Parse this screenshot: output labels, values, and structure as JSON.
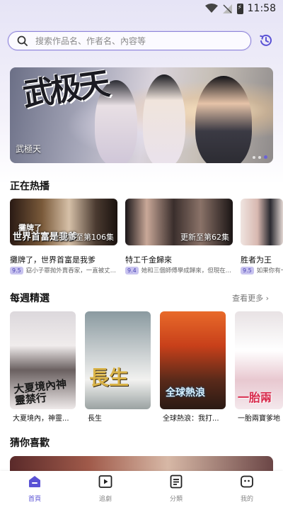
{
  "status_bar": {
    "time": "11:58"
  },
  "search": {
    "placeholder": "搜索作品名、作者名、內容等"
  },
  "banner": {
    "calligraphy": "武极天",
    "title": "武極天"
  },
  "sections": {
    "hot": {
      "title": "正在热播"
    },
    "weekly": {
      "title": "每週精選",
      "more": "查看更多 ›"
    },
    "guess": {
      "title": "猜你喜歡"
    }
  },
  "hot_items": [
    {
      "name": "攤牌了，世界首富是我爹",
      "score": "9.5",
      "desc": "窈小子罪抛外賣吞家，一直被丈...",
      "episodes": "更新至第106集",
      "overlay_top": "攤牌了",
      "overlay": "世界首富是我爹"
    },
    {
      "name": "特工千金歸來",
      "score": "9.4",
      "desc": "她和三個師傅學成歸來，但現在...",
      "episodes": "更新至第62集"
    },
    {
      "name": "胜者为王",
      "score": "9.5",
      "desc": "如果你有一"
    }
  ],
  "weekly_items": [
    {
      "name": "大夏境內，神靈...",
      "poster_text": "大夏境內神靈禁行"
    },
    {
      "name": "長生",
      "poster_text": "長生"
    },
    {
      "name": "全球熱浪：我打...",
      "poster_text": "全球熱浪"
    },
    {
      "name": "一胎兩寶爹地",
      "poster_text": "一胎兩"
    }
  ],
  "tabs": [
    {
      "label": "首頁",
      "icon": "home-icon",
      "active": true
    },
    {
      "label": "追劇",
      "icon": "play-icon",
      "active": false
    },
    {
      "label": "分類",
      "icon": "list-icon",
      "active": false
    },
    {
      "label": "我的",
      "icon": "profile-icon",
      "active": false
    }
  ],
  "colors": {
    "accent": "#5a52d5",
    "search_border": "#8f86d8",
    "score_bg": "#c8c3ef"
  }
}
